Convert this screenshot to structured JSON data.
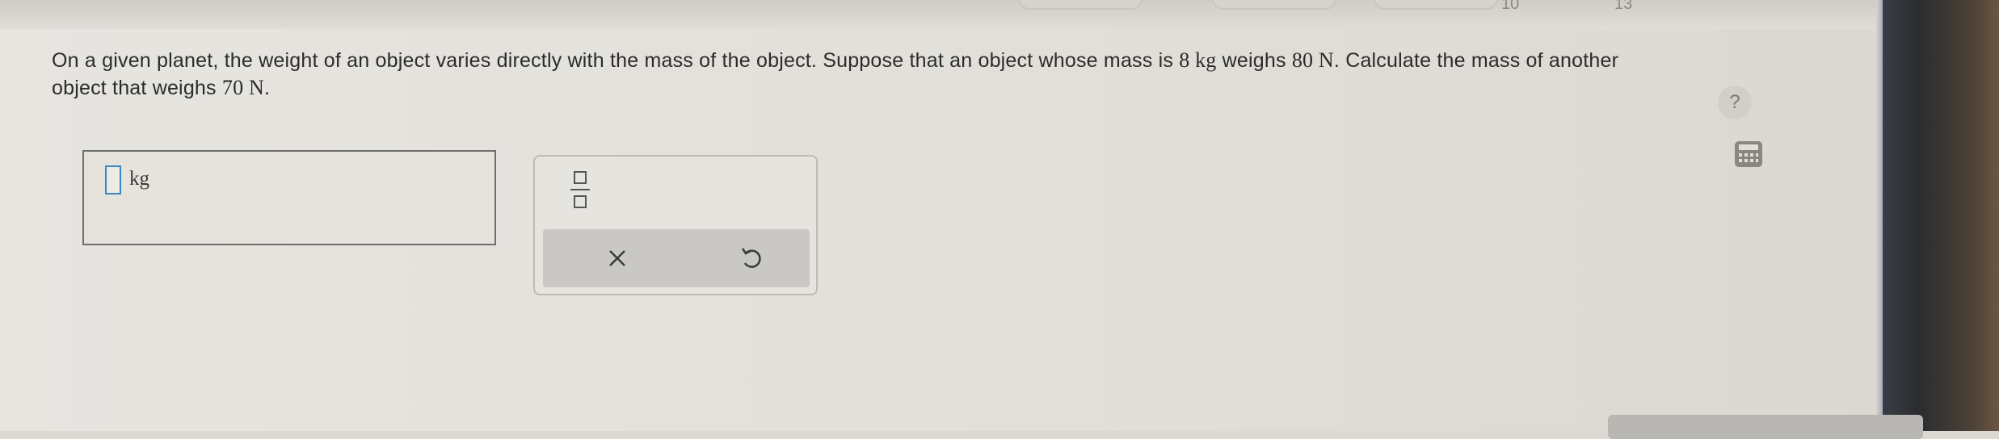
{
  "question": {
    "part1": "On a given planet, the weight of an object varies directly with the mass of the object. Suppose that an object whose mass is ",
    "mass_value": "8 kg",
    "part2": " weighs ",
    "weight_value": "80 N",
    "part3": ". Calculate the mass of another object that weighs ",
    "target_weight": "70 N",
    "part4": "."
  },
  "answer": {
    "value": "",
    "unit": "kg"
  },
  "toolbox": {
    "fraction_icon": "fraction-icon",
    "clear_icon": "close-icon",
    "undo_icon": "undo-icon"
  },
  "side_tools": {
    "help_label": "?",
    "calculator_icon": "calculator-icon"
  },
  "top_bar": {
    "digits": [
      "10",
      "13"
    ]
  },
  "colors": {
    "input_border": "#3d86c6",
    "text": "#2b2b2b",
    "toolbar_bg": "#c9c8c4"
  }
}
